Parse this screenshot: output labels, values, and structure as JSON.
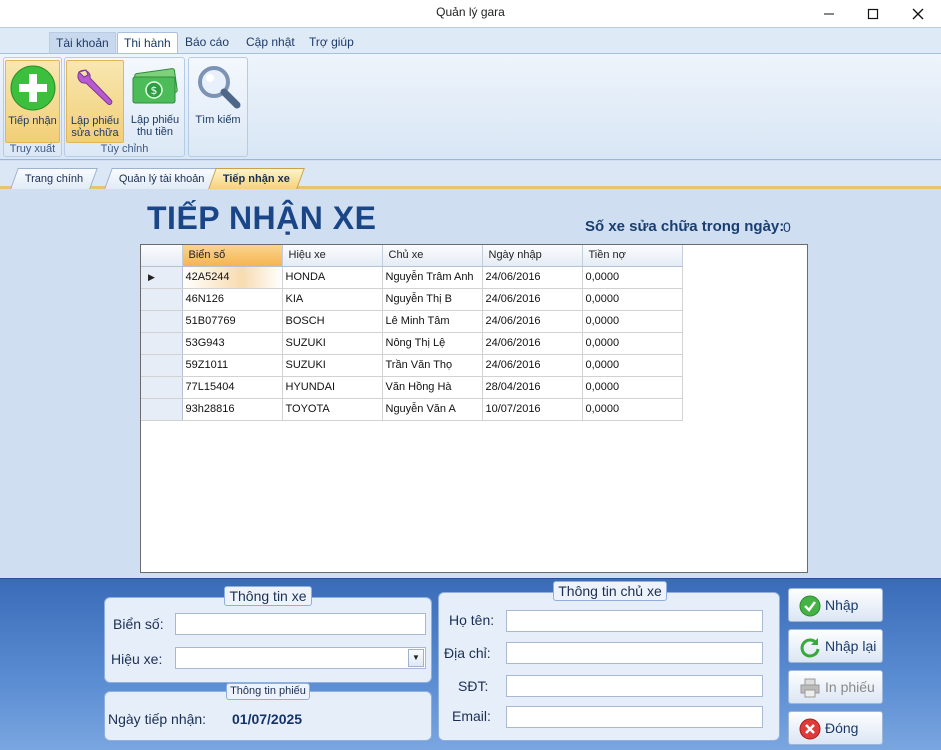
{
  "window": {
    "title": "Quản lý gara"
  },
  "ribbon_tabs": [
    "Tài khoản",
    "Thi hành",
    "Báo cáo",
    "Cập nhật",
    "Trợ giúp"
  ],
  "ribbon": {
    "groups": [
      {
        "label": "Truy xuất",
        "buttons": [
          {
            "label_line1": "Tiếp nhận",
            "label_line2": "",
            "icon": "add-icon"
          }
        ]
      },
      {
        "label": "Tùy chỉnh",
        "buttons": [
          {
            "label_line1": "Lập phiếu",
            "label_line2": "sửa chữa",
            "icon": "wrench-icon"
          },
          {
            "label_line1": "Lập phiếu",
            "label_line2": "thu tiền",
            "icon": "money-icon"
          }
        ]
      },
      {
        "label": "",
        "buttons": [
          {
            "label_line1": "Tìm kiếm",
            "label_line2": "",
            "icon": "search-icon"
          }
        ]
      }
    ]
  },
  "doc_tabs": [
    "Trang chính",
    "Quản lý tài khoản",
    "Tiếp nhận xe"
  ],
  "page": {
    "heading": "TIẾP NHẬN XE",
    "count_label": "Số xe sửa chữa trong ngày:",
    "count_value": "0"
  },
  "grid": {
    "columns": [
      "Biển số",
      "Hiệu xe",
      "Chủ xe",
      "Ngày nhập",
      "Tiền nợ"
    ],
    "rows": [
      [
        "42A5244",
        "HONDA",
        "Nguyễn Trâm Anh",
        "24/06/2016",
        "0,0000"
      ],
      [
        "46N126",
        "KIA",
        "Nguyễn Thị B",
        "24/06/2016",
        "0,0000"
      ],
      [
        "51B07769",
        "BOSCH",
        "Lê Minh Tâm",
        "24/06/2016",
        "0,0000"
      ],
      [
        "53G943",
        "SUZUKI",
        "Nông Thị Lệ",
        "24/06/2016",
        "0,0000"
      ],
      [
        "59Z1011",
        "SUZUKI",
        "Trần Văn Thọ",
        "24/06/2016",
        "0,0000"
      ],
      [
        "77L15404",
        "HYUNDAI",
        "Văn Hồng Hà",
        "28/04/2016",
        "0,0000"
      ],
      [
        "93h28816",
        "TOYOTA",
        "Nguyễn Văn A",
        "10/07/2016",
        "0,0000"
      ]
    ]
  },
  "form": {
    "car_box_title": "Thông tin xe",
    "plate_label": "Biển số:",
    "plate_value": "",
    "brand_label": "Hiệu xe:",
    "brand_value": "",
    "receipt_box_title": "Thông tin phiếu",
    "date_label": "Ngày tiếp nhận:",
    "date_value": "01/07/2025",
    "owner_box_title": "Thông tin chủ xe",
    "name_label": "Họ tên:",
    "name_value": "",
    "address_label": "Địa chỉ:",
    "address_value": "",
    "phone_label": "SĐT:",
    "phone_value": "",
    "email_label": "Email:",
    "email_value": ""
  },
  "actions": {
    "submit": "Nhập",
    "reset": "Nhập lại",
    "print": "In phiếu",
    "close": "Đóng"
  }
}
